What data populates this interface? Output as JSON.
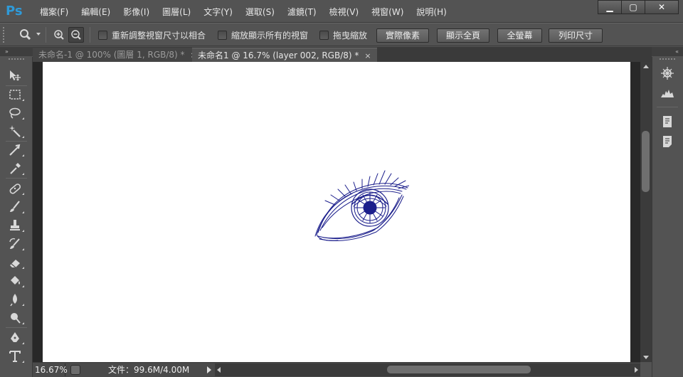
{
  "app": {
    "logo": "Ps"
  },
  "menu": {
    "items": [
      "檔案(F)",
      "編輯(E)",
      "影像(I)",
      "圖層(L)",
      "文字(Y)",
      "選取(S)",
      "濾鏡(T)",
      "檢視(V)",
      "視窗(W)",
      "說明(H)"
    ]
  },
  "window_controls": {
    "minimize": "▁",
    "maximize": "▢",
    "close": "✕"
  },
  "options": {
    "resize_windows": "重新調整視窗尺寸以相合",
    "zoom_all_windows": "縮放顯示所有的視窗",
    "scrubby_zoom": "拖曳縮放",
    "actual_pixels": "實際像素",
    "fit_screen": "顯示全頁",
    "fill_screen": "全螢幕",
    "print_size": "列印尺寸"
  },
  "tabs": [
    {
      "label": "未命名-1 @ 100% (圖層 1, RGB/8) *",
      "active": false,
      "close": "×"
    },
    {
      "label": "未命名1 @ 16.7% (layer 002, RGB/8) *",
      "active": true,
      "close": "×"
    }
  ],
  "panel_collapse": {
    "left": "»",
    "right": "«"
  },
  "status": {
    "zoom": "16.67%",
    "doc_info": "文件：99.6M/4.00M"
  },
  "colors": {
    "ui_bg": "#535353",
    "accent_logo": "#2f9ad8",
    "sketch_ink": "#1c1f8c",
    "canvas": "#ffffff"
  },
  "icons": {
    "tools": [
      "move-icon",
      "marquee-icon",
      "lasso-icon",
      "magic-wand-icon",
      "crop-icon",
      "eyedropper-icon",
      "healing-brush-icon",
      "brush-icon",
      "clone-stamp-icon",
      "history-brush-icon",
      "eraser-icon",
      "paint-bucket-icon",
      "blur-icon",
      "dodge-icon",
      "pen-icon",
      "type-icon"
    ],
    "panels": [
      "navigator-icon",
      "histogram-icon",
      "book-icon",
      "notes-icon"
    ]
  }
}
